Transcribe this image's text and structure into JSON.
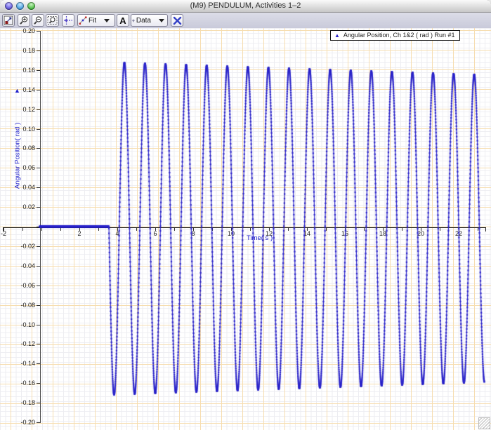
{
  "window": {
    "title": "(M9) PENDULUM, Activities 1–2"
  },
  "toolbar": {
    "fit_label": "Fit",
    "text_tool_label": "A",
    "data_label": "Data"
  },
  "legend": {
    "marker": "▲",
    "label": "Angular Position, Ch 1&2 ( rad ) Run #1"
  },
  "chart_data": {
    "type": "line",
    "title": "",
    "xlabel": "Time( s )",
    "ylabel": "Angular Position( rad )",
    "ylabel_marker": "▲",
    "xlim": [
      -2,
      23.4
    ],
    "ylim": [
      -0.2,
      0.2
    ],
    "x_tick_step": 1,
    "x_labeled_ticks": [
      -2,
      2,
      4,
      6,
      8,
      10,
      12,
      14,
      16,
      18,
      20,
      22
    ],
    "y_tick_step": 0.02,
    "grid": "graph-paper",
    "legend_position": "top-right",
    "series": [
      {
        "name": "Angular Position, Ch 1&2 ( rad ) Run #1",
        "color": "#2a23c9",
        "marker": "triangle",
        "sample_interval_s": 0.005,
        "segments": [
          {
            "type": "flat",
            "t_start": -0.1,
            "t_end": 3.56,
            "value": 0
          },
          {
            "type": "damped_sine",
            "t_start": 3.56,
            "t_end": 23.35,
            "amplitude_rad": 0.17,
            "offset_rad": -0.002,
            "decay_per_s": 0.004,
            "period_s": 1.085,
            "initial_direction": "down"
          }
        ],
        "first_peak_rad": 0.166,
        "last_peak_rad": 0.155,
        "first_trough_rad": -0.172,
        "last_trough_rad": -0.162
      }
    ]
  },
  "colors": {
    "trace": "#2a23c9",
    "grid_major": "#f6ddb0",
    "grid_minor": "#ededf1",
    "axis": "#222222",
    "axis_label_blue": "#2222cc"
  }
}
